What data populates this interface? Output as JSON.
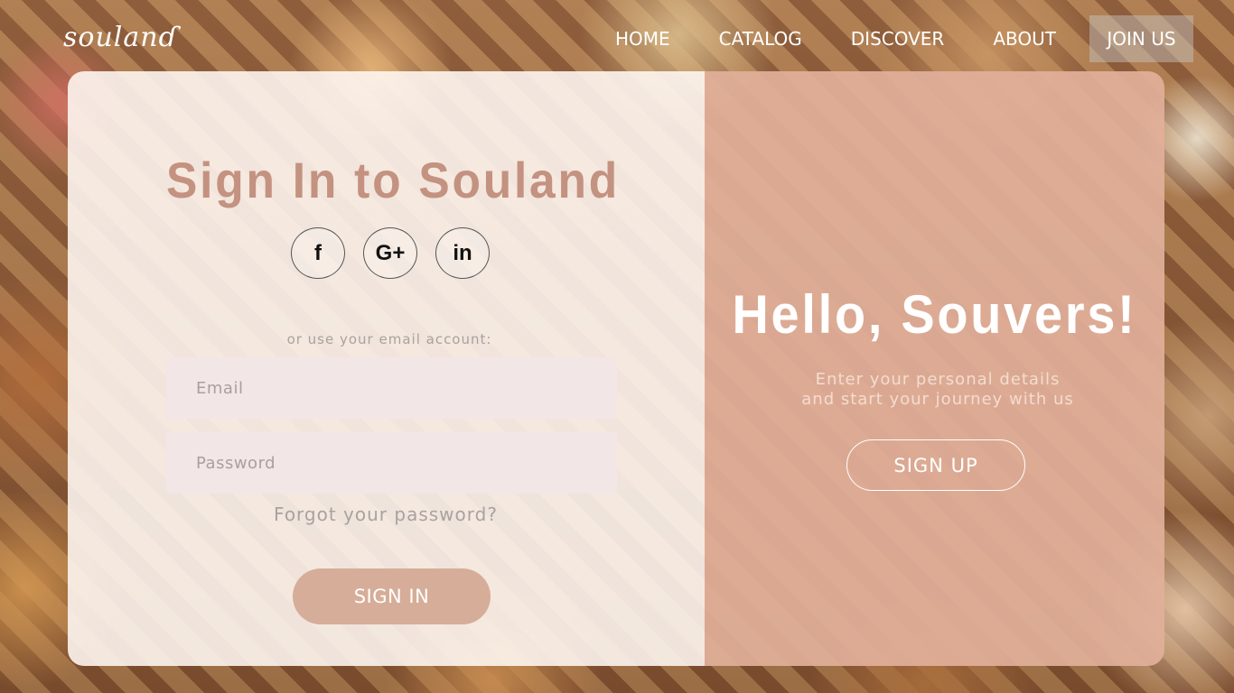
{
  "header": {
    "logo": "soulanɗ",
    "nav": {
      "home": "HOME",
      "catalog": "CATALOG",
      "discover": "DISCOVER",
      "about": "ABOUT",
      "join": "JOIN US"
    }
  },
  "signin": {
    "title": "Sign In to Souland",
    "social": {
      "facebook": "f",
      "google": "G+",
      "linkedin": "in"
    },
    "or_text": "or use your email account:",
    "email_placeholder": "Email",
    "password_placeholder": "Password",
    "forgot": "Forgot your password?",
    "button": "SIGN IN"
  },
  "signup": {
    "title": "Hello, Souvers!",
    "subtitle_line1": "Enter your personal details",
    "subtitle_line2": "and start your journey with us",
    "button": "SIGN UP"
  },
  "colors": {
    "accent": "#d6ad98",
    "title": "#c49280",
    "panel": "#e2b09a",
    "field_bg": "#f3e6e6"
  },
  "icons": {
    "facebook": "facebook-icon",
    "google": "google-plus-icon",
    "linkedin": "linkedin-icon"
  }
}
